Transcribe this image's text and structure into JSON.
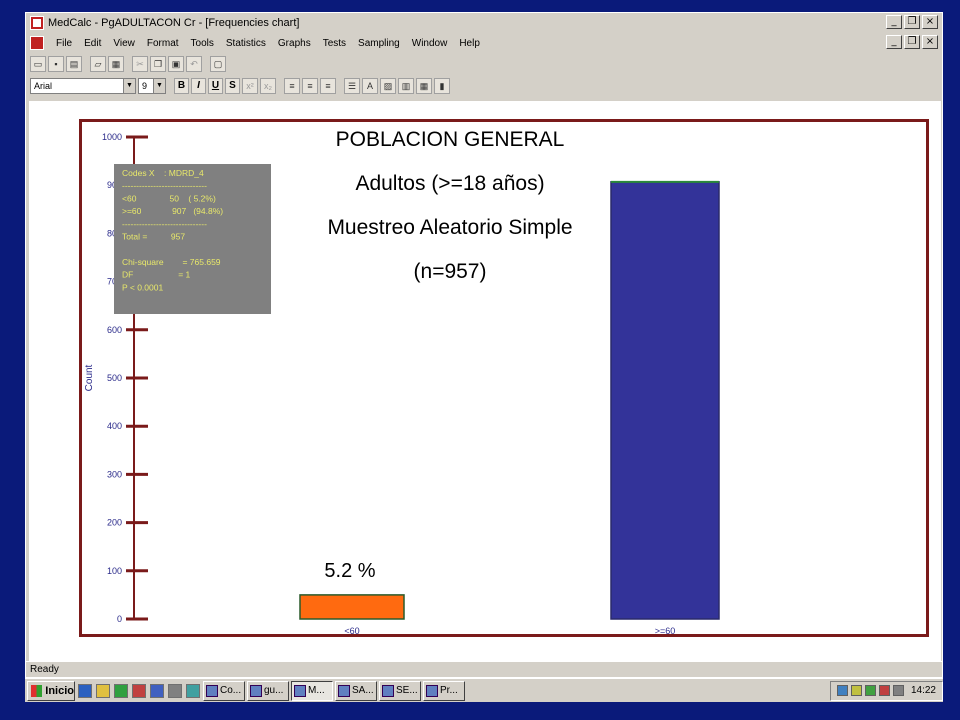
{
  "window": {
    "title": "MedCalc - PgADULTACON Cr - [Frequencies chart]",
    "menu": [
      "File",
      "Edit",
      "View",
      "Format",
      "Tools",
      "Statistics",
      "Graphs",
      "Tests",
      "Sampling",
      "Window",
      "Help"
    ],
    "font_name": "Arial",
    "font_size": "9",
    "format_buttons": [
      "B",
      "I",
      "U",
      "S"
    ],
    "status": "Ready"
  },
  "taskbar": {
    "start_label": "Inicio",
    "tasks": [
      "Co...",
      "gu...",
      "M...",
      "SA...",
      "SE...",
      "Pr..."
    ],
    "clock": "14:22"
  },
  "chart_data": {
    "type": "bar",
    "title_lines": [
      "POBLACION GENERAL",
      "Adultos (>=18 años)",
      "Muestreo Aleatorio Simple",
      "(n=957)"
    ],
    "categories": [
      "<60",
      ">=60"
    ],
    "values": [
      50,
      907
    ],
    "colors": [
      "#ff6a10",
      "#333399"
    ],
    "xlabel": "MDRD_4",
    "ylabel": "Count",
    "ylim": [
      0,
      1000
    ],
    "yticks": [
      0,
      100,
      200,
      300,
      400,
      500,
      600,
      700,
      800,
      900,
      1000
    ],
    "annotation": "5.2 %",
    "stats_box": [
      "Codes X    : MDRD_4",
      "------------------------------",
      "<60              50    ( 5.2%)",
      ">=60             907   (94.8%)",
      "------------------------------",
      "Total =          957",
      "",
      "Chi-square        = 765.659",
      "DF                   = 1",
      "P < 0.0001"
    ]
  }
}
